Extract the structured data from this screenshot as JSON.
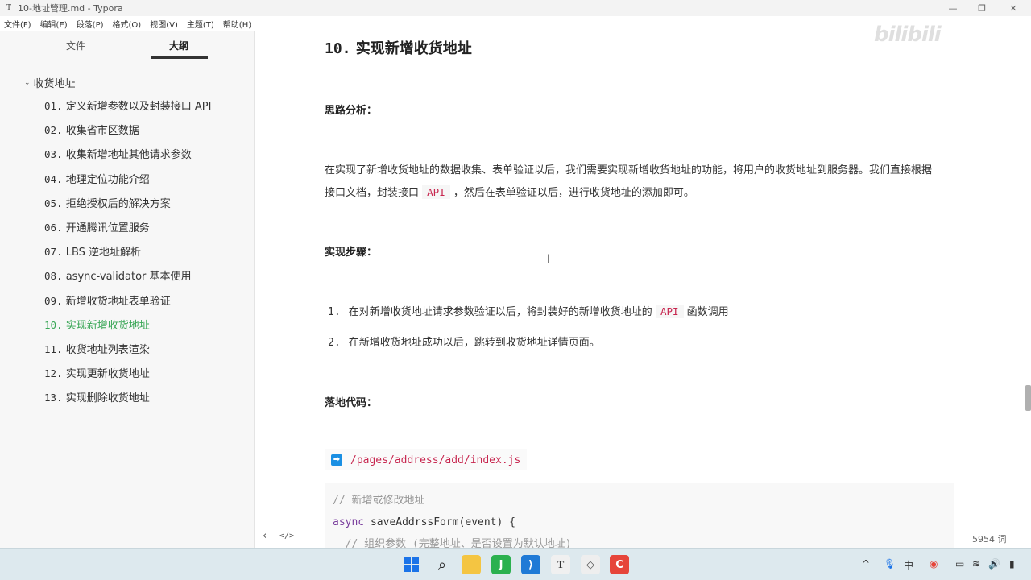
{
  "window": {
    "title": "10-地址管理.md - Typora",
    "app_icon": "T"
  },
  "menu": [
    "文件(F)",
    "编辑(E)",
    "段落(P)",
    "格式(O)",
    "视图(V)",
    "主题(T)",
    "帮助(H)"
  ],
  "sidebar": {
    "tabs": [
      "文件",
      "大纲"
    ],
    "active_tab": "大纲",
    "root": "收货地址",
    "items": [
      {
        "num": "01.",
        "label": "定义新增参数以及封装接口 API"
      },
      {
        "num": "02.",
        "label": "收集省市区数据"
      },
      {
        "num": "03.",
        "label": "收集新增地址其他请求参数"
      },
      {
        "num": "04.",
        "label": "地理定位功能介绍"
      },
      {
        "num": "05.",
        "label": "拒绝授权后的解决方案"
      },
      {
        "num": "06.",
        "label": "开通腾讯位置服务"
      },
      {
        "num": "07.",
        "label": "LBS 逆地址解析"
      },
      {
        "num": "08.",
        "label": "async-validator 基本使用"
      },
      {
        "num": "09.",
        "label": "新增收货地址表单验证"
      },
      {
        "num": "10.",
        "label": "实现新增收货地址"
      },
      {
        "num": "11.",
        "label": "收货地址列表渲染"
      },
      {
        "num": "12.",
        "label": "实现更新收货地址"
      },
      {
        "num": "13.",
        "label": "实现删除收货地址"
      }
    ],
    "active_index": 9,
    "accent_color": "#3aa757"
  },
  "main": {
    "heading_num": "10.",
    "heading_text": "实现新增收货地址",
    "section1": "思路分析：",
    "para_line1": "在实现了新增收货地址的数据收集、表单验证以后，我们需要实现新增收货地址的功能，将用户的收货地址到服务器。我们直接根据",
    "para_line2_a": "接口文档，封装接口",
    "para_code": "API",
    "para_line2_b": "，然后在表单验证以后，进行收货地址的添加即可。",
    "section2": "实现步骤：",
    "step1_num": "1.",
    "step1_a": "在对新增收货地址请求参数验证以后，将封装好的新增收货地址的",
    "step1_code": "API",
    "step1_b": "函数调用",
    "step2_num": "2.",
    "step2": "在新增收货地址成功以后，跳转到收货地址详情页面。",
    "section3": "落地代码：",
    "file_path": "/pages/address/add/index.js",
    "code_lines": [
      "// 新增或修改地址",
      "async saveAddrssForm(event) {",
      "  // 组织参数 (完整地址、是否设置为默认地址)"
    ],
    "word_count": "5954 词"
  },
  "watermark": "bilibili"
}
